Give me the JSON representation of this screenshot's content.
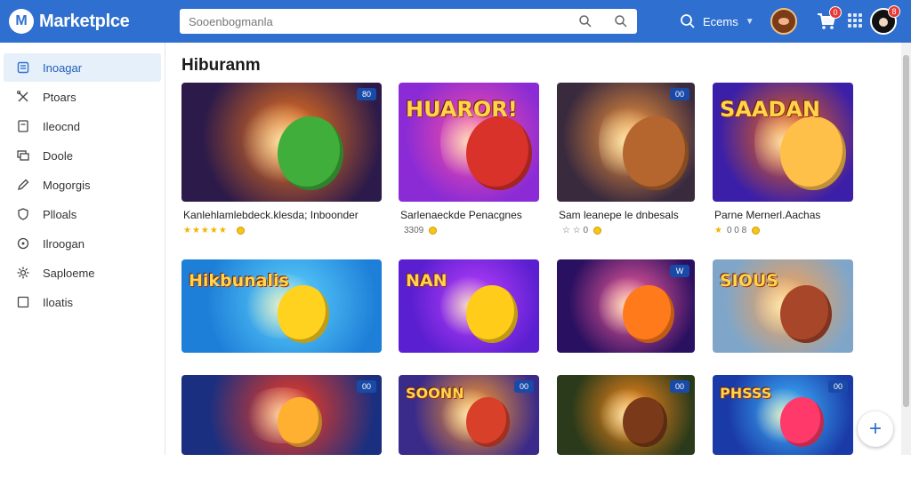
{
  "app": {
    "logo_letter": "M",
    "name": "Marketplce",
    "brand_color": "#2f6fd0"
  },
  "search": {
    "placeholder": "Sooenbogmanla"
  },
  "topbar": {
    "search_label": "Ecems",
    "cart_count": "0",
    "avatar_count": "8"
  },
  "sidebar": {
    "items": [
      {
        "label": "Inoagar",
        "icon": "store-icon",
        "active": true
      },
      {
        "label": "Ptoars",
        "icon": "tools-icon"
      },
      {
        "label": "Ileocnd",
        "icon": "document-icon"
      },
      {
        "label": "Doole",
        "icon": "layers-icon"
      },
      {
        "label": "Mogorgis",
        "icon": "pencil-icon"
      },
      {
        "label": "Plloals",
        "icon": "shield-icon"
      },
      {
        "label": "Ilroogan",
        "icon": "refresh-icon"
      },
      {
        "label": "Saploeme",
        "icon": "gear-icon"
      },
      {
        "label": "Iloatis",
        "icon": "square-icon"
      }
    ]
  },
  "main": {
    "title": "Hiburanm",
    "cards": [
      {
        "name": "Kanlehlamlebdeck.klesda; Inboonder",
        "stars": "★★★★★",
        "meta": "",
        "tag": "80",
        "art": "",
        "c1": "#2b1a4a",
        "c2": "#ff7a18",
        "c3": "#3fae3a"
      },
      {
        "name": "Sarlenaeckde Penacgnes",
        "stars": "",
        "meta": "3309",
        "tag": "",
        "art": "HUAROR!",
        "c1": "#8a2bd6",
        "c2": "#ff4fa0",
        "c3": "#d8322a"
      },
      {
        "name": "Sam leanepe le dnbesals",
        "stars": "",
        "meta": "☆ ☆ 0",
        "tag": "00",
        "art": "",
        "c1": "#3a2a3e",
        "c2": "#ff9a3c",
        "c3": "#b5652e"
      },
      {
        "name": "Parne Mernerl.Aachas",
        "stars": "★",
        "meta": "0 0 8",
        "tag": "",
        "art": "SAADAN",
        "c1": "#3b1fa8",
        "c2": "#ff6a00",
        "c3": "#ffc04a"
      },
      {
        "name": "",
        "stars": "",
        "meta": "",
        "tag": "",
        "art": "Hikbunalis",
        "c1": "#1e7fd8",
        "c2": "#5fd4ff",
        "c3": "#ffd21f"
      },
      {
        "name": "",
        "stars": "",
        "meta": "",
        "tag": "",
        "art": "NAN",
        "c1": "#5a1fd0",
        "c2": "#c040ff",
        "c3": "#ffcc1a"
      },
      {
        "name": "",
        "stars": "",
        "meta": "",
        "tag": "W",
        "art": "",
        "c1": "#2a1060",
        "c2": "#ff5fa0",
        "c3": "#ff7a1a"
      },
      {
        "name": "",
        "stars": "",
        "meta": "",
        "tag": "",
        "art": "SIOUS",
        "c1": "#7fa6c9",
        "c2": "#ff9f4a",
        "c3": "#a8462a"
      },
      {
        "name": "",
        "stars": "",
        "meta": "",
        "tag": "00",
        "art": "",
        "c1": "#1a2f80",
        "c2": "#ff3a1a",
        "c3": "#ffb030"
      },
      {
        "name": "",
        "stars": "",
        "meta": "",
        "tag": "00",
        "art": "SOONN",
        "c1": "#3a2a8a",
        "c2": "#ff9a2a",
        "c3": "#d8402a"
      },
      {
        "name": "",
        "stars": "",
        "meta": "",
        "tag": "00",
        "art": "",
        "c1": "#2a3a1a",
        "c2": "#ff8a1a",
        "c3": "#7a3a1a"
      },
      {
        "name": "",
        "stars": "",
        "meta": "",
        "tag": "00",
        "art": "PHSSS",
        "c1": "#1a3aa8",
        "c2": "#3fbaff",
        "c3": "#ff3a6a"
      }
    ]
  },
  "fab": {
    "label": "+"
  }
}
